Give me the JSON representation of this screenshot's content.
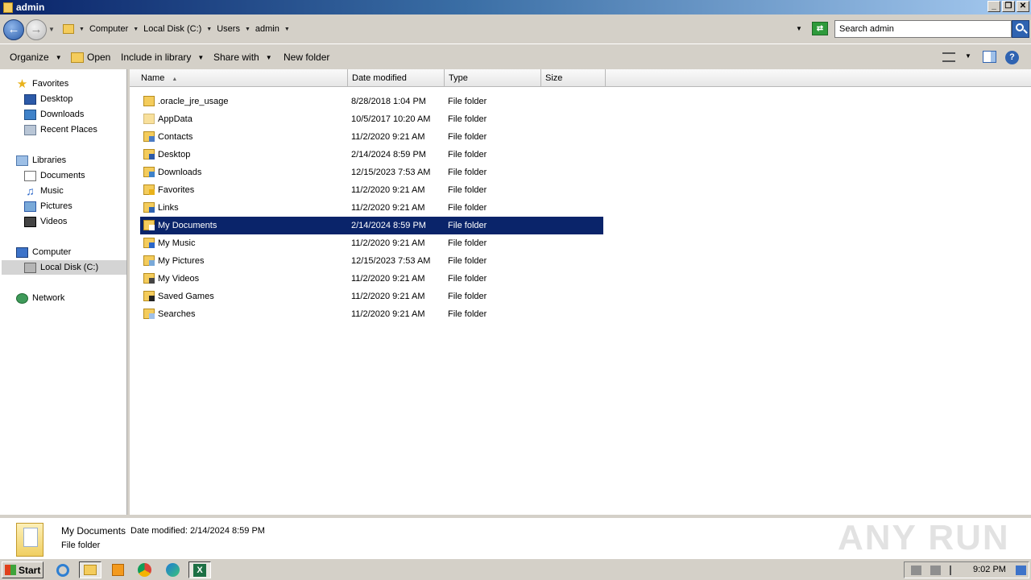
{
  "window": {
    "title": "admin",
    "minimize": "_",
    "restore": "❐",
    "close": "✕"
  },
  "address": {
    "crumbs": [
      "Computer",
      "Local Disk (C:)",
      "Users",
      "admin"
    ],
    "search_placeholder": "Search admin"
  },
  "toolbar": {
    "organize": "Organize",
    "open": "Open",
    "include_in_library": "Include in library",
    "share_with": "Share with",
    "new_folder": "New folder",
    "help": "?"
  },
  "nav": {
    "favorites": "Favorites",
    "desktop": "Desktop",
    "downloads": "Downloads",
    "recent_places": "Recent Places",
    "libraries": "Libraries",
    "documents": "Documents",
    "music": "Music",
    "pictures": "Pictures",
    "videos": "Videos",
    "computer": "Computer",
    "local_disk": "Local Disk (C:)",
    "network": "Network"
  },
  "columns": {
    "name": "Name",
    "date_modified": "Date modified",
    "type": "Type",
    "size": "Size"
  },
  "files": [
    {
      "name": ".oracle_jre_usage",
      "date": "8/28/2018 1:04 PM",
      "type": "File folder"
    },
    {
      "name": "AppData",
      "date": "10/5/2017 10:20 AM",
      "type": "File folder"
    },
    {
      "name": "Contacts",
      "date": "11/2/2020 9:21 AM",
      "type": "File folder"
    },
    {
      "name": "Desktop",
      "date": "2/14/2024 8:59 PM",
      "type": "File folder"
    },
    {
      "name": "Downloads",
      "date": "12/15/2023 7:53 AM",
      "type": "File folder"
    },
    {
      "name": "Favorites",
      "date": "11/2/2020 9:21 AM",
      "type": "File folder"
    },
    {
      "name": "Links",
      "date": "11/2/2020 9:21 AM",
      "type": "File folder"
    },
    {
      "name": "My Documents",
      "date": "2/14/2024 8:59 PM",
      "type": "File folder"
    },
    {
      "name": "My Music",
      "date": "11/2/2020 9:21 AM",
      "type": "File folder"
    },
    {
      "name": "My Pictures",
      "date": "12/15/2023 7:53 AM",
      "type": "File folder"
    },
    {
      "name": "My Videos",
      "date": "11/2/2020 9:21 AM",
      "type": "File folder"
    },
    {
      "name": "Saved Games",
      "date": "11/2/2020 9:21 AM",
      "type": "File folder"
    },
    {
      "name": "Searches",
      "date": "11/2/2020 9:21 AM",
      "type": "File folder"
    }
  ],
  "details": {
    "name": "My Documents",
    "date_label": "Date modified:",
    "date_value": "2/14/2024 8:59 PM",
    "type": "File folder"
  },
  "watermark": "ANY RUN",
  "taskbar": {
    "start": "Start",
    "excel_letter": "X",
    "clock": "9:02 PM"
  },
  "colors": {
    "selection": "#0a246a",
    "chrome": "#d4d0c8",
    "folder": "#f4cc5c"
  }
}
